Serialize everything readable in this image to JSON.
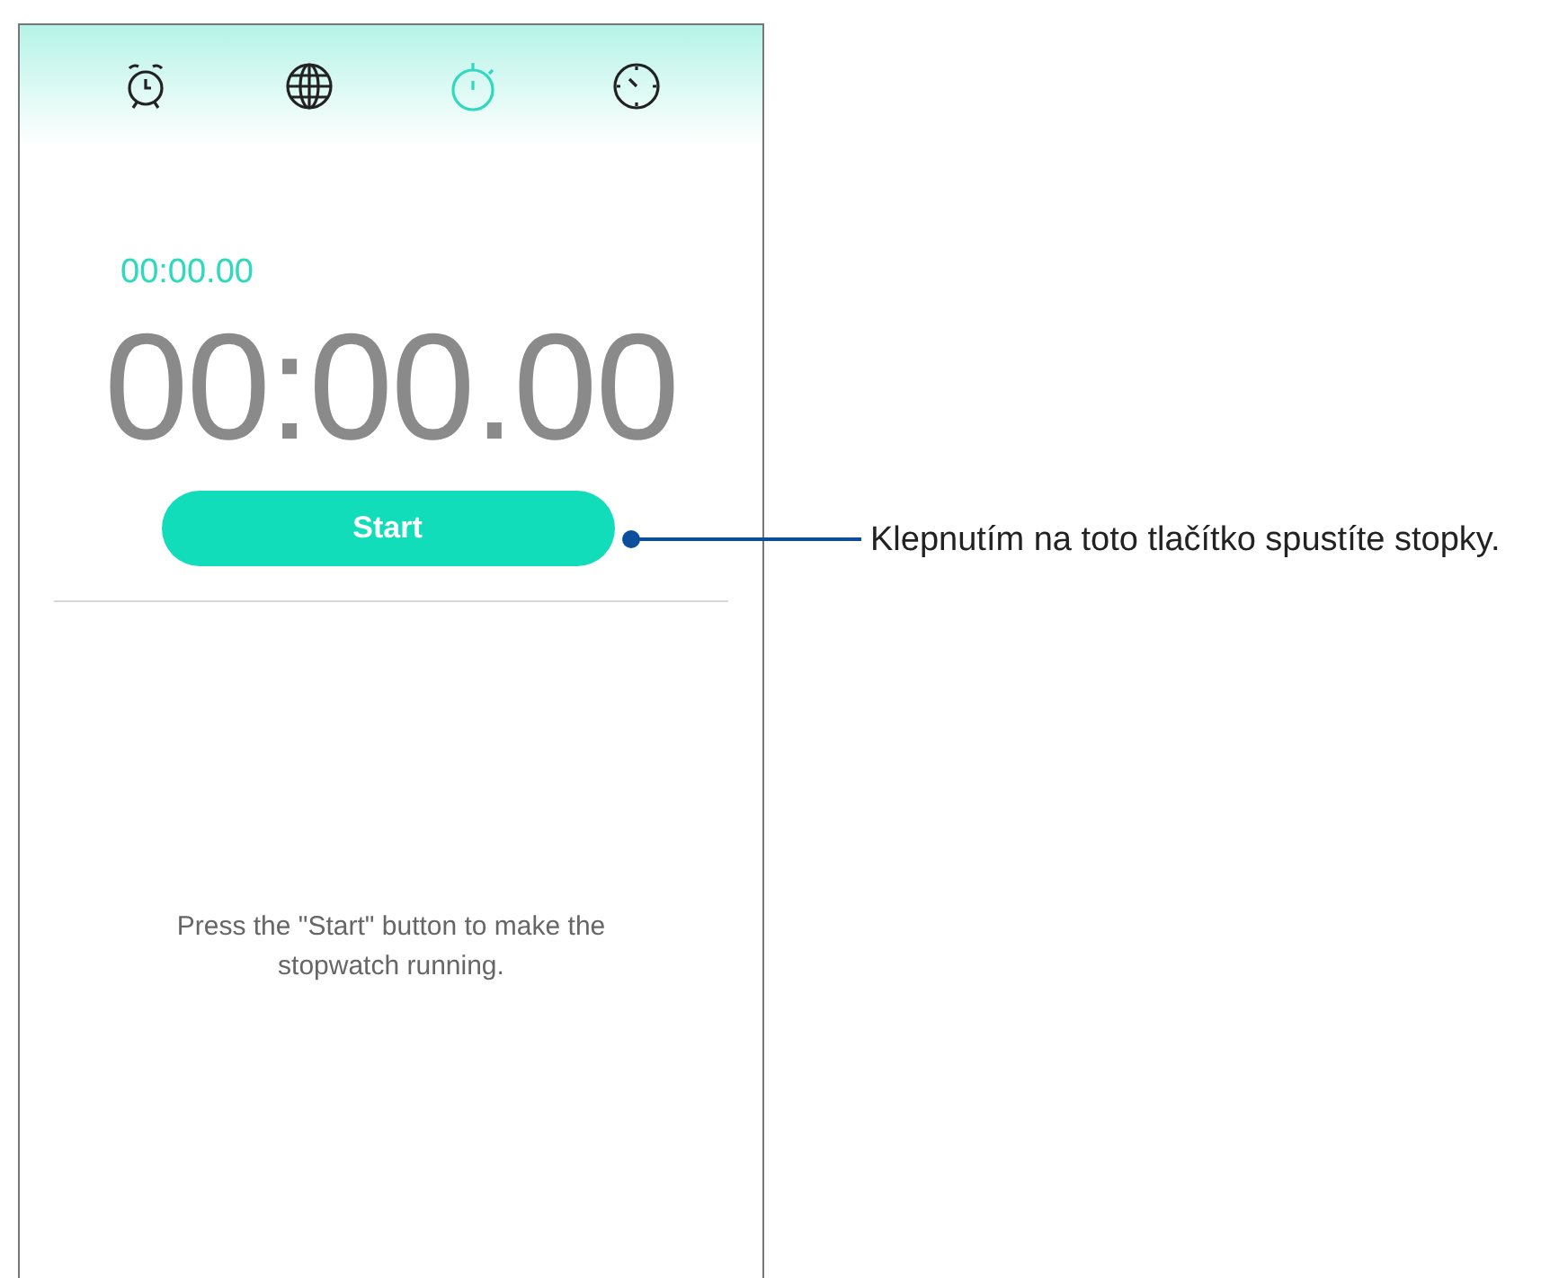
{
  "tabs": [
    {
      "kind": "alarm",
      "selected": false
    },
    {
      "kind": "world",
      "selected": false
    },
    {
      "kind": "stopwatch",
      "selected": true
    },
    {
      "kind": "timer",
      "selected": false
    }
  ],
  "lap_time": "00:00.00",
  "time": "00:00.00",
  "start_button": "Start",
  "message": "Press the \"Start\" button to make the stopwatch running.",
  "callout": "Klepnutím na toto tlačítko spustíte stopky."
}
